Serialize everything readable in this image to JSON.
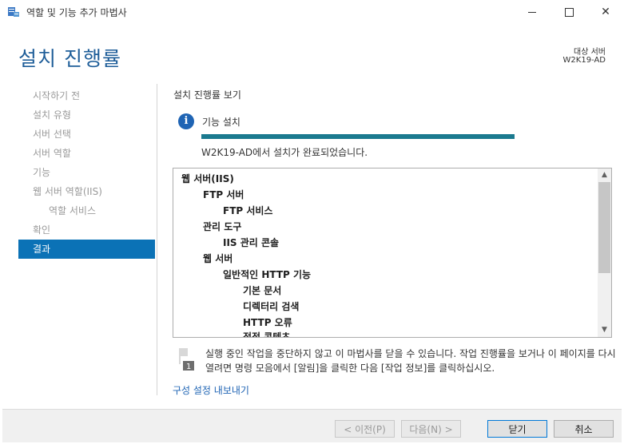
{
  "window": {
    "title": "역할 및 기능 추가 마법사",
    "controls": {
      "minimize": "minimize-icon",
      "maximize": "maximize-icon",
      "close": "close-icon"
    }
  },
  "header": {
    "page_title": "설치 진행률",
    "destination_label": "대상 서버",
    "destination_server": "W2K19-AD"
  },
  "nav": {
    "items": [
      {
        "label": "시작하기 전",
        "sub": false,
        "active": false
      },
      {
        "label": "설치 유형",
        "sub": false,
        "active": false
      },
      {
        "label": "서버 선택",
        "sub": false,
        "active": false
      },
      {
        "label": "서버 역할",
        "sub": false,
        "active": false
      },
      {
        "label": "기능",
        "sub": false,
        "active": false
      },
      {
        "label": "웹 서버 역할(IIS)",
        "sub": false,
        "active": false
      },
      {
        "label": "역할 서비스",
        "sub": true,
        "active": false
      },
      {
        "label": "확인",
        "sub": false,
        "active": false
      },
      {
        "label": "결과",
        "sub": false,
        "active": true
      }
    ]
  },
  "main": {
    "section_title": "설치 진행률 보기",
    "feature_label": "기능 설치",
    "progress_fraction": 1.0,
    "status_text": "W2K19-AD에서 설치가 완료되었습니다.",
    "results": [
      {
        "text": "웹 서버(IIS)",
        "level": 0
      },
      {
        "text": "FTP 서버",
        "level": 1
      },
      {
        "text": "FTP 서비스",
        "level": 2
      },
      {
        "text": "관리 도구",
        "level": 1
      },
      {
        "text": "IIS 관리 콘솔",
        "level": 2
      },
      {
        "text": "웹 서버",
        "level": 1
      },
      {
        "text": "일반적인 HTTP 기능",
        "level": 2
      },
      {
        "text": "기본 문서",
        "level": 3
      },
      {
        "text": "디렉터리 검색",
        "level": 3
      },
      {
        "text": "HTTP 오류",
        "level": 3
      },
      {
        "text": "정적 콘텐츠",
        "level": 3
      }
    ],
    "notice": "실행 중인 작업을 중단하지 않고 이 마법사를 닫을 수 있습니다. 작업 진행률을 보거나 이 페이지를 다시 열려면 명령 모음에서 [알림]을 클릭한 다음 [작업 정보]를 클릭하십시오.",
    "export_link": "구성 설정 내보내기"
  },
  "footer": {
    "prev": "< 이전(P)",
    "next": "다음(N) >",
    "close": "닫기",
    "cancel": "취소"
  },
  "colors": {
    "title_blue": "#1f5e99",
    "nav_active": "#0b72b6",
    "progress": "#1b7a8f",
    "link": "#1f64b4"
  }
}
